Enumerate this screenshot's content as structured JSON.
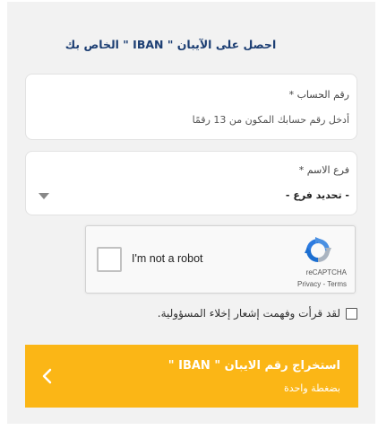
{
  "form": {
    "title": "احصل على الآيبان \" IBAN \" الخاص بك",
    "account": {
      "label": "رقم الحساب *",
      "placeholder": "أدخل رقم حسابك المكون من 13 رقمًا"
    },
    "branch": {
      "label": "فرع الاسم *",
      "selected": "- تحديد فرع -"
    },
    "captcha": {
      "checkbox_label": "I'm not a robot",
      "brand": "reCAPTCHA",
      "privacy_link": "Privacy",
      "separator": "-",
      "terms_link": "Terms"
    },
    "consent": {
      "text": "لقد قرأت وفهمت إشعار إخلاء المسؤولية.",
      "checked": false
    },
    "submit": {
      "title": "استخراج رقم الايبان \" IBAN \"",
      "subtitle": "بضغطة واحدة"
    }
  },
  "colors": {
    "panel": "#f2f2f2",
    "title": "#1c3e73",
    "button": "#fbb616",
    "button_text": "#ffffff"
  },
  "icons": {
    "dropdown": "caret-down-icon",
    "captcha": "recaptcha-logo-icon",
    "submit": "chevron-left-icon"
  }
}
